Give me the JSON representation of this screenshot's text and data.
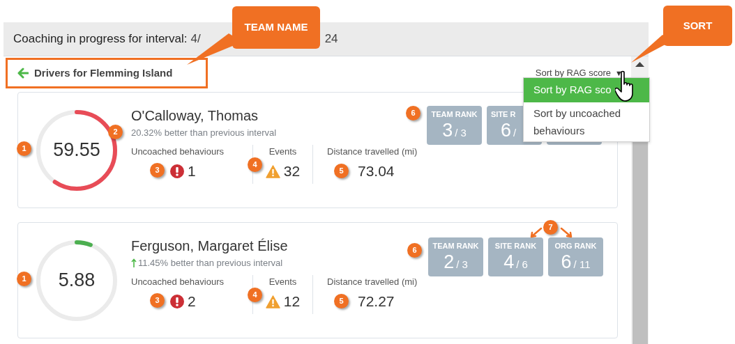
{
  "header": {
    "label": "Coaching in progress for interval:",
    "value_start": "4/",
    "value_end": "24"
  },
  "team_link": {
    "label": "Drivers for Flemming Island"
  },
  "sort": {
    "label": "Sort by RAG score",
    "caret": "▼",
    "options": [
      {
        "label": "Sort by RAG sco",
        "selected": true
      },
      {
        "label": "Sort by uncoached behaviours",
        "selected": false
      }
    ]
  },
  "callouts": [
    {
      "kind": "team",
      "label": "TEAM NAME"
    },
    {
      "kind": "sort",
      "label": "SORT"
    }
  ],
  "drivers": [
    {
      "name": "O'Calloway, Thomas",
      "score": "59.55",
      "level": 0.5955,
      "color": "#e84c57",
      "arrow": false,
      "change": "20.32% better than previous interval",
      "score_marker": "1",
      "change_marker": "2",
      "stats": [
        {
          "kind": "alert",
          "label": "Uncoached behaviours",
          "value": "1",
          "marker": "3"
        },
        {
          "kind": "warning",
          "label": "Events",
          "value": "32",
          "marker": "4"
        },
        {
          "kind": "plain",
          "label": "Distance travelled (mi)",
          "value": "73.04",
          "marker": "5"
        }
      ],
      "rank_marker": "6",
      "ranks": [
        {
          "label": "TEAM RANK",
          "value": "3",
          "total": "/ 3"
        },
        {
          "kind": "partial",
          "label": "SITE R",
          "value": "6",
          "total": "/"
        },
        {
          "kind": "hidden"
        }
      ]
    },
    {
      "name": "Ferguson, Margaret Élise",
      "score": "5.88",
      "level": 0.0588,
      "color": "#4caf50",
      "arrow": true,
      "change": "11.45% better than previous interval",
      "score_marker": "1",
      "stats": [
        {
          "kind": "alert",
          "label": "Uncoached behaviours",
          "value": "2",
          "marker": "3"
        },
        {
          "kind": "warning",
          "label": "Events",
          "value": "12",
          "marker": "4"
        },
        {
          "kind": "plain",
          "label": "Distance travelled (mi)",
          "value": "72.27",
          "marker": "5"
        }
      ],
      "rank_marker": "6",
      "pointer_marker": "7",
      "ranks": [
        {
          "label": "TEAM RANK",
          "value": "2",
          "total": "/ 3"
        },
        {
          "label": "SITE RANK",
          "value": "4",
          "total": "/ 6"
        },
        {
          "label": "ORG RANK",
          "value": "6",
          "total": "/ 11"
        }
      ]
    }
  ]
}
